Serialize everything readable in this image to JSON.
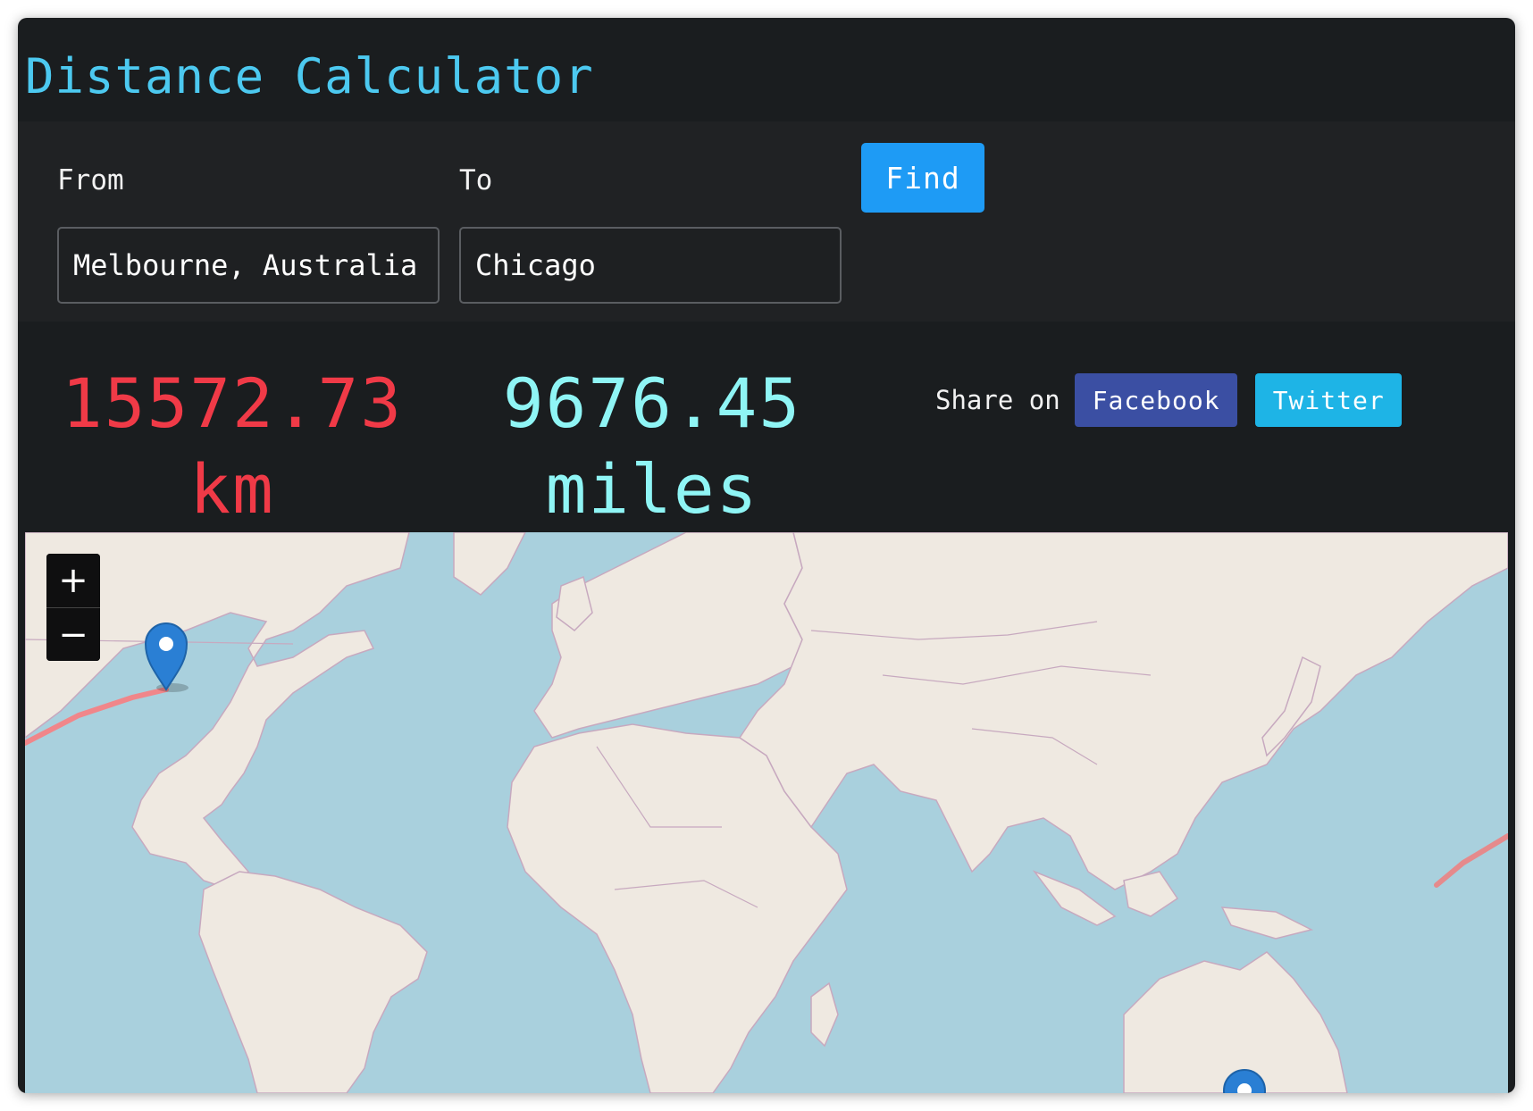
{
  "app": {
    "title": "Distance Calculator"
  },
  "form": {
    "from_label": "From",
    "from_value": "Melbourne, Australia",
    "to_label": "To",
    "to_value": "Chicago",
    "find_label": "Find"
  },
  "results": {
    "km_value": "15572.73",
    "km_unit": "km",
    "miles_value": "9676.45",
    "miles_unit": "miles"
  },
  "share": {
    "label": "Share on",
    "facebook": "Facebook",
    "twitter": "Twitter"
  },
  "map": {
    "zoom_in": "+",
    "zoom_out": "−",
    "route_color": "#f0868a",
    "marker_color": "#2a7fd4",
    "land_color": "#efe9e1",
    "water_color": "#a9d0dd"
  },
  "colors": {
    "title": "#4cc9f0",
    "km": "#f03a47",
    "miles": "#8ff5f5",
    "find": "#1e9bf5",
    "facebook": "#3b4fa3",
    "twitter": "#1eb4e6"
  }
}
